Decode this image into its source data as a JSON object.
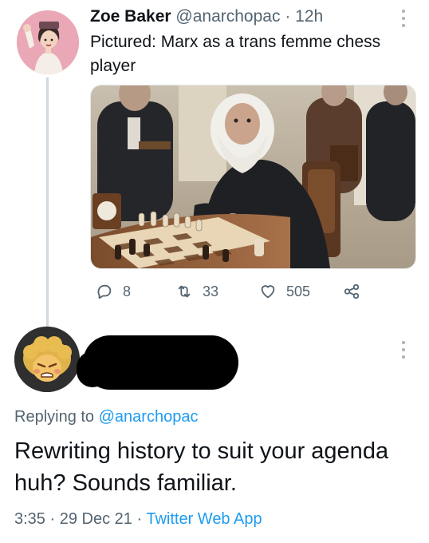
{
  "tweet": {
    "author_name": "Zoe Baker",
    "author_handle": "@anarchopac",
    "separator": "·",
    "time": "12h",
    "text": "Pictured: Marx as a trans femme chess player",
    "stats": {
      "replies": "8",
      "retweets": "33",
      "likes": "505"
    }
  },
  "reply": {
    "replying_prefix": "Replying to",
    "replying_handle": "@anarchopac",
    "text": "Rewriting history to suit your agenda huh? Sounds familiar.",
    "time": "3:35",
    "date": "29 Dec 21",
    "separator": "·",
    "app": "Twitter Web App"
  },
  "colors": {
    "text": "#0f1419",
    "secondary": "#536471",
    "link": "#1d9bf0",
    "thread_line": "#cfd9de"
  },
  "icons": [
    "reply-icon",
    "retweet-icon",
    "like-icon",
    "share-icon",
    "more-icon"
  ]
}
